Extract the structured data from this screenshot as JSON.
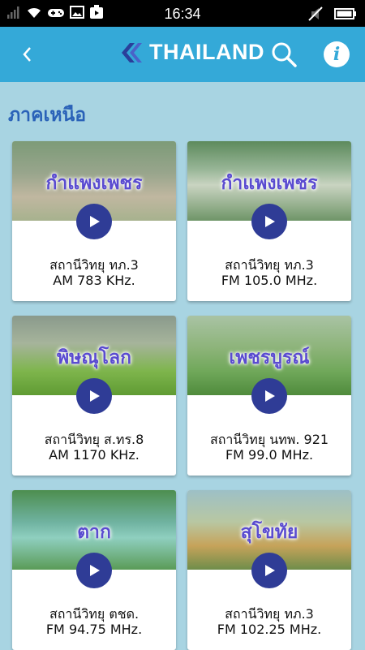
{
  "status_bar": {
    "time": "16:34",
    "icons_left": [
      "signal-icon",
      "wifi-icon",
      "game-controller-icon",
      "image-icon",
      "media-icon"
    ],
    "icons_right": [
      "mute-icon",
      "battery-icon"
    ]
  },
  "app_bar": {
    "title": "THAILAND",
    "back_icon": "chevron-left-icon",
    "search_icon": "search-icon",
    "info_icon": "info-icon",
    "info_label": "i"
  },
  "region": {
    "title": "ภาคเหนือ"
  },
  "stations": [
    {
      "province": "กำแพงเพชร",
      "station": "สถานีวิทยุ ทภ.3",
      "frequency": "AM 783 KHz."
    },
    {
      "province": "กำแพงเพชร",
      "station": "สถานีวิทยุ ทภ.3",
      "frequency": "FM 105.0 MHz."
    },
    {
      "province": "พิษณุโลก",
      "station": "สถานีวิทยุ ส.ทร.8",
      "frequency": "AM 1170 KHz."
    },
    {
      "province": "เพชรบูรณ์",
      "station": "สถานีวิทยุ นทพ. 921",
      "frequency": "FM 99.0 MHz."
    },
    {
      "province": "ตาก",
      "station": "สถานีวิทยุ ตชด.",
      "frequency": "FM 94.75 MHz."
    },
    {
      "province": "สุโขทัย",
      "station": "สถานีวิทยุ ทภ.3",
      "frequency": "FM 102.25 MHz."
    }
  ],
  "colors": {
    "app_bar": "#34a9d8",
    "background": "#a8d4e2",
    "region_title": "#2a62b8",
    "play_button": "#2f3c96",
    "province_text": "#5a4bd0"
  }
}
